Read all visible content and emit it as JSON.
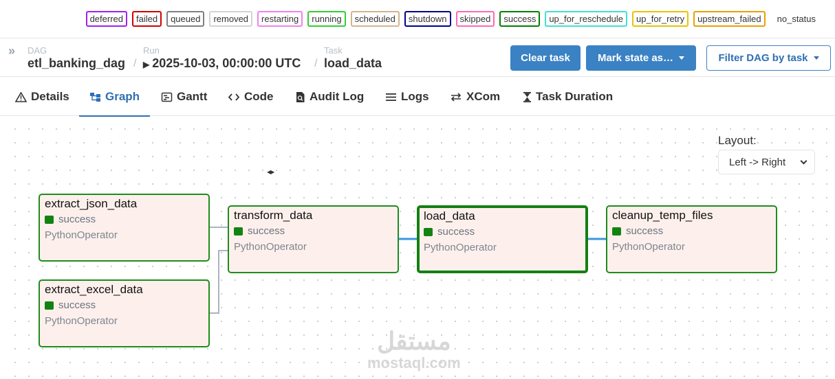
{
  "legend": [
    {
      "label": "deferred",
      "color": "#a020f0"
    },
    {
      "label": "failed",
      "color": "#d10000"
    },
    {
      "label": "queued",
      "color": "#808080"
    },
    {
      "label": "removed",
      "color": "#d3d3d3"
    },
    {
      "label": "restarting",
      "color": "#ee82ee"
    },
    {
      "label": "running",
      "color": "#32cd32"
    },
    {
      "label": "scheduled",
      "color": "#d2b48c"
    },
    {
      "label": "shutdown",
      "color": "#00008b"
    },
    {
      "label": "skipped",
      "color": "#ff69b4"
    },
    {
      "label": "success",
      "color": "#008000"
    },
    {
      "label": "up_for_reschedule",
      "color": "#40e0d0"
    },
    {
      "label": "up_for_retry",
      "color": "#e6c300"
    },
    {
      "label": "upstream_failed",
      "color": "#e8a000"
    },
    {
      "label": "no_status",
      "color": ""
    }
  ],
  "breadcrumb": {
    "dag_label": "DAG",
    "dag_value": "etl_banking_dag",
    "run_label": "Run",
    "run_value": "2025-10-03, 00:00:00 UTC",
    "task_label": "Task",
    "task_value": "load_data"
  },
  "actions": {
    "clear_task": "Clear task",
    "mark_state": "Mark state as…",
    "filter_dag": "Filter DAG by task"
  },
  "tabs": [
    {
      "label": "Details",
      "icon": "warning-icon"
    },
    {
      "label": "Graph",
      "icon": "graph-icon"
    },
    {
      "label": "Gantt",
      "icon": "gantt-icon"
    },
    {
      "label": "Code",
      "icon": "code-icon"
    },
    {
      "label": "Audit Log",
      "icon": "audit-log-icon"
    },
    {
      "label": "Logs",
      "icon": "logs-icon"
    },
    {
      "label": "XCom",
      "icon": "xcom-icon"
    },
    {
      "label": "Task Duration",
      "icon": "hourglass-icon"
    }
  ],
  "active_tab": "Graph",
  "layout": {
    "label": "Layout:",
    "selected": "Left -> Right"
  },
  "nodes": [
    {
      "id": "extract_json_data",
      "state": "success",
      "operator": "PythonOperator"
    },
    {
      "id": "extract_excel_data",
      "state": "success",
      "operator": "PythonOperator"
    },
    {
      "id": "transform_data",
      "state": "success",
      "operator": "PythonOperator"
    },
    {
      "id": "load_data",
      "state": "success",
      "operator": "PythonOperator",
      "selected": true
    },
    {
      "id": "cleanup_temp_files",
      "state": "success",
      "operator": "PythonOperator"
    }
  ],
  "edges": [
    {
      "from": "extract_json_data",
      "to": "transform_data"
    },
    {
      "from": "extract_excel_data",
      "to": "transform_data"
    },
    {
      "from": "transform_data",
      "to": "load_data"
    },
    {
      "from": "load_data",
      "to": "cleanup_temp_files"
    }
  ],
  "colors": {
    "accent": "#3b82c4",
    "success": "#128312",
    "node_bg": "#fdf0ec",
    "edge_highlight": "#3b97e0",
    "edge": "#a9b4c0"
  },
  "watermark": {
    "arabic": "مستقل",
    "latin": "mostaql.com"
  }
}
